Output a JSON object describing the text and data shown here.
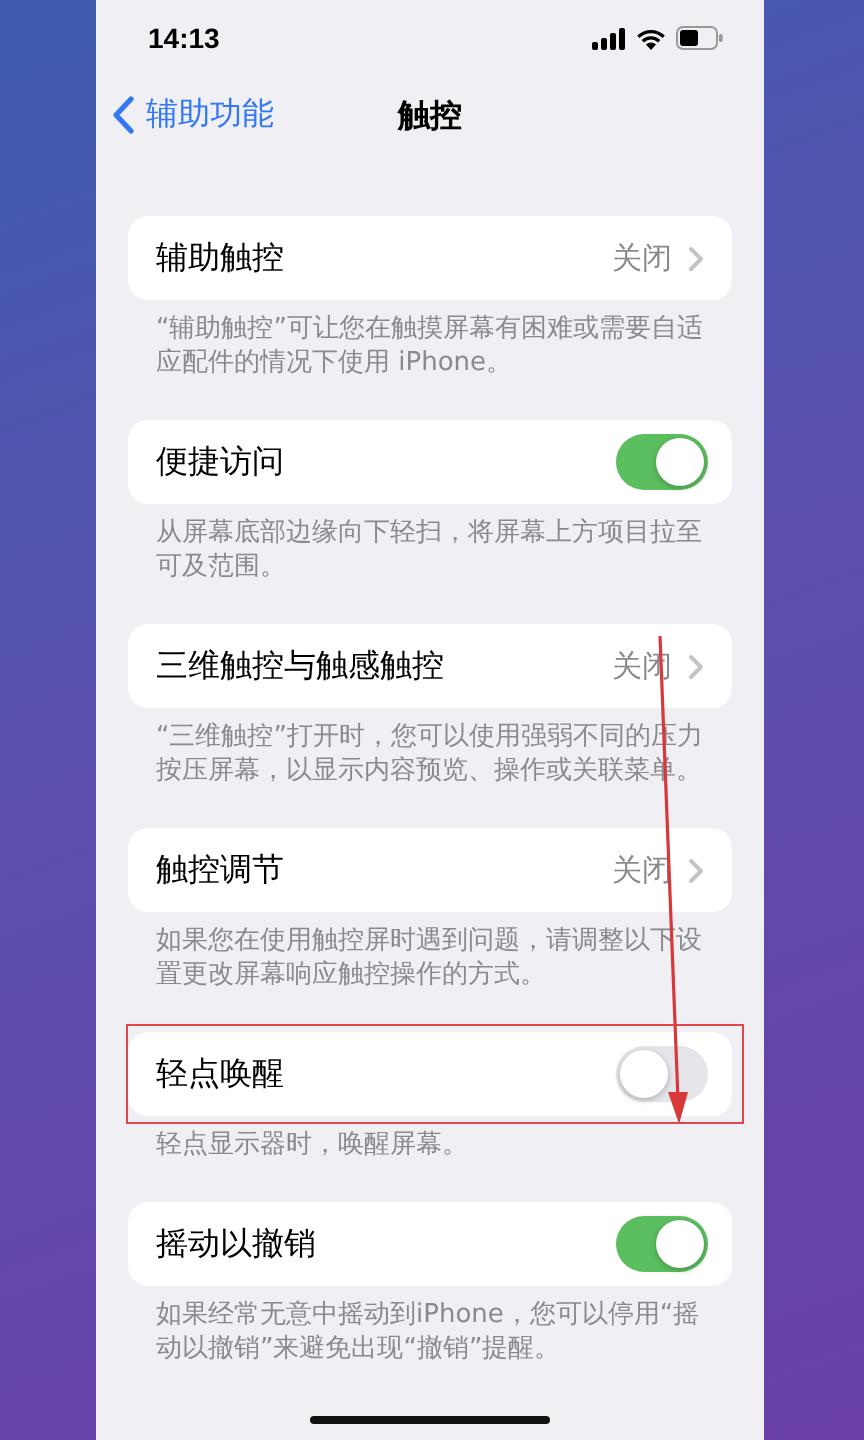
{
  "status_bar": {
    "time": "14:13"
  },
  "nav": {
    "back": "辅助功能",
    "title": "触控"
  },
  "sections": [
    {
      "kind": "value",
      "label": "辅助触控",
      "value": "关闭",
      "highlighted": false,
      "footer": "“辅助触控”可让您在触摸屏幕有困难或需要自适应配件的情况下使用 iPhone。"
    },
    {
      "kind": "toggle",
      "label": "便捷访问",
      "on": true,
      "highlighted": false,
      "footer": "从屏幕底部边缘向下轻扫，将屏幕上方项目拉至可及范围。"
    },
    {
      "kind": "value",
      "label": "三维触控与触感触控",
      "value": "关闭",
      "highlighted": false,
      "footer": "“三维触控”打开时，您可以使用强弱不同的压力按压屏幕，以显示内容预览、操作或关联菜单。"
    },
    {
      "kind": "value",
      "label": "触控调节",
      "value": "关闭",
      "highlighted": false,
      "footer": "如果您在使用触控屏时遇到问题，请调整以下设置更改屏幕响应触控操作的方式。"
    },
    {
      "kind": "toggle",
      "label": "轻点唤醒",
      "on": false,
      "highlighted": true,
      "footer": "轻点显示器时，唤醒屏幕。"
    },
    {
      "kind": "toggle",
      "label": "摇动以撤销",
      "on": true,
      "highlighted": false,
      "footer": "如果经常无意中摇动到iPhone，您可以停用“摇动以撤销”来避免出现“撤销”提醒。"
    }
  ]
}
